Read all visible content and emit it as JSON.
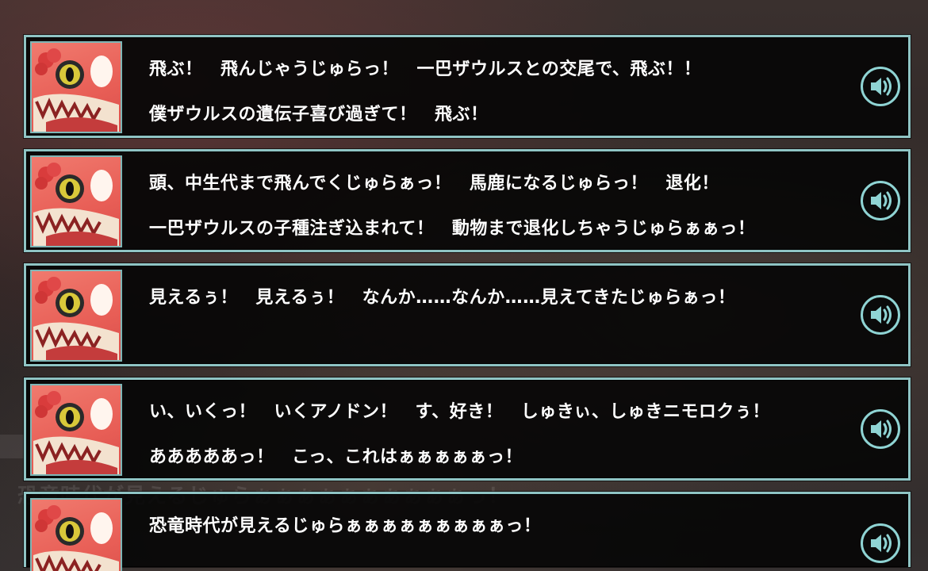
{
  "background": {
    "ghost_text": "恐竜時代が見えるじゅらぁぁぁぁぁぁぁぁぁぁっ！"
  },
  "colors": {
    "frame_border": "#8fc4c4",
    "voice_button_ring": "#8fd4d4",
    "text": "#ffffff",
    "panel_bg": "#050505",
    "portrait_bg": "#e85e56"
  },
  "icons": {
    "voice": "speaker-icon",
    "portrait": "character-portrait"
  },
  "log": [
    {
      "lines": [
        "飛ぶ！　飛んじゃうじゅらっ！　一巴ザウルスとの交尾で、飛ぶ！！",
        "僕ザウルスの遺伝子喜び過ぎて！　飛ぶ！"
      ]
    },
    {
      "lines": [
        "頭、中生代まで飛んでくじゅらぁっ！　馬鹿になるじゅらっ！　退化！",
        "一巴ザウルスの子種注ぎ込まれて！　動物まで退化しちゃうじゅらぁぁっ！"
      ]
    },
    {
      "lines": [
        "見えるぅ！　見えるぅ！　なんか……なんか……見えてきたじゅらぁっ！",
        ""
      ]
    },
    {
      "lines": [
        "い、いくっ！　いくアノドン！　す、好き！　しゅきぃ、しゅきニモロクぅ！",
        "あああああっ！　こっ、これはぁぁぁぁぁっ！"
      ]
    },
    {
      "lines": [
        "恐竜時代が見えるじゅらぁぁぁぁぁぁぁぁぁっ！",
        ""
      ]
    }
  ]
}
